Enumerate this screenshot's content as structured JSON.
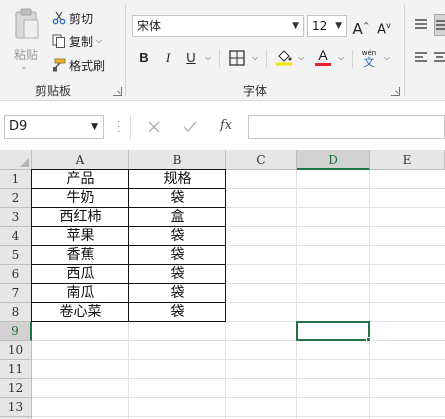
{
  "ribbon": {
    "clipboard": {
      "paste_label": "粘贴",
      "cut_label": "剪切",
      "copy_label": "复制",
      "format_painter_label": "格式刷",
      "group_label": "剪贴板"
    },
    "font": {
      "font_name": "宋体",
      "font_size": "12",
      "bold": "B",
      "italic": "I",
      "underline": "U",
      "font_color_letter": "A",
      "grow_letter": "A",
      "shrink_letter": "A",
      "wen_label": "wén",
      "wen_char": "文",
      "group_label": "字体",
      "highlight_color": "#f5e400",
      "font_color": "#e0252a"
    }
  },
  "formula_bar": {
    "name_box": "D9",
    "fx_label": "fx",
    "value": ""
  },
  "sheet": {
    "columns": [
      "A",
      "B",
      "C",
      "D",
      "E"
    ],
    "rows": [
      "1",
      "2",
      "3",
      "4",
      "5",
      "6",
      "7",
      "8",
      "9",
      "10",
      "11",
      "12",
      "13",
      "14"
    ],
    "selected_cell": "D9",
    "cells": {
      "A1": "产品",
      "B1": "规格",
      "A2": "牛奶",
      "B2": "袋",
      "A3": "西红柿",
      "B3": "盒",
      "A4": "苹果",
      "B4": "袋",
      "A5": "香蕉",
      "B5": "袋",
      "A6": "西瓜",
      "B6": "袋",
      "A7": "南瓜",
      "B7": "袋",
      "A8": "卷心菜",
      "B8": "袋"
    },
    "accent_color": "#217346"
  }
}
